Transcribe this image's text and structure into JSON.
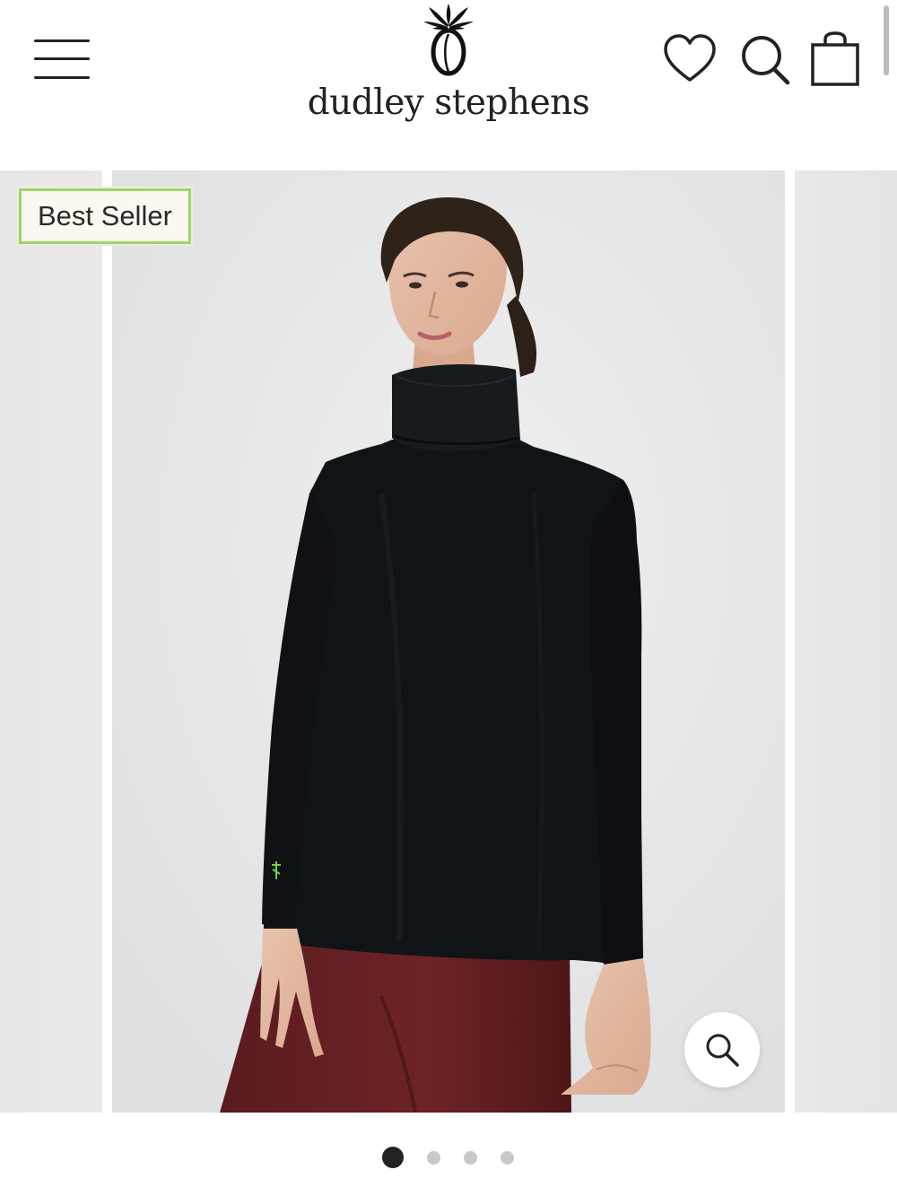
{
  "header": {
    "brand": "dudley stephens",
    "icons": [
      "menu-icon",
      "pineapple-logo-icon",
      "heart-icon",
      "search-icon",
      "bag-icon"
    ]
  },
  "product_gallery": {
    "badge": "Best Seller",
    "image_subject": "",
    "zoom_icon": "magnifier-icon",
    "slide_count": 4,
    "active_slide": 1
  },
  "colors": {
    "badge_border": "#9cd66b",
    "badge_background": "#fbf8ef",
    "text": "#222222",
    "photo_background": "#e9eaeb"
  }
}
